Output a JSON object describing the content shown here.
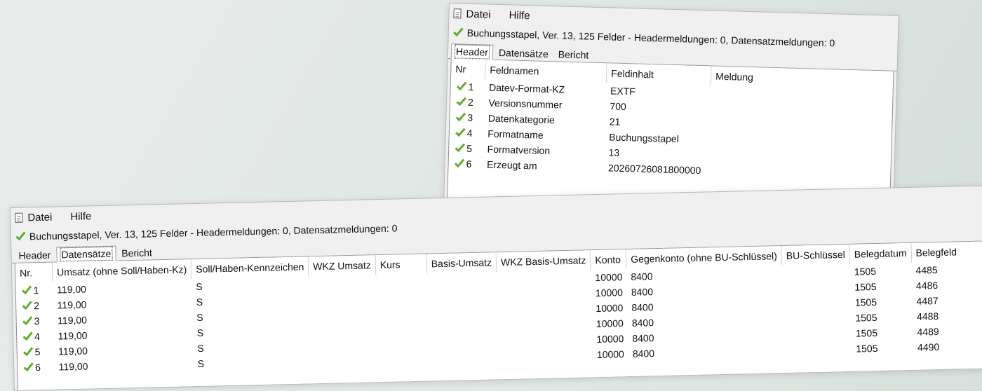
{
  "menu": {
    "file": "Datei",
    "help": "Hilfe"
  },
  "icons": {
    "file_menu": "document-icon",
    "status": "check-icon",
    "row": "check-icon"
  },
  "colors": {
    "check": "#5fae2e"
  },
  "back_window": {
    "status_text": "Buchungsstapel, Ver. 13, 125 Felder - Headermeldungen: 0, Datensatzmeldungen: 0",
    "tabs": [
      "Header",
      "Datensätze",
      "Bericht"
    ],
    "active_tab": "Header",
    "columns": [
      "Nr",
      "Feldnamen",
      "Feldinhalt",
      "Meldung"
    ],
    "rows": [
      {
        "nr": "1",
        "name": "Datev-Format-KZ",
        "value": "EXTF",
        "message": ""
      },
      {
        "nr": "2",
        "name": "Versionsnummer",
        "value": "700",
        "message": ""
      },
      {
        "nr": "3",
        "name": "Datenkategorie",
        "value": "21",
        "message": ""
      },
      {
        "nr": "4",
        "name": "Formatname",
        "value": "Buchungsstapel",
        "message": ""
      },
      {
        "nr": "5",
        "name": "Formatversion",
        "value": "13",
        "message": ""
      },
      {
        "nr": "6",
        "name": "Erzeugt am",
        "value": "20260726081800000",
        "message": ""
      }
    ]
  },
  "front_window": {
    "status_text": "Buchungsstapel, Ver. 13, 125 Felder - Headermeldungen: 0, Datensatzmeldungen: 0",
    "tabs": [
      "Header",
      "Datensätze",
      "Bericht"
    ],
    "active_tab": "Datensätze",
    "columns": [
      "Nr.",
      "Umsatz (ohne Soll/Haben-Kz)",
      "Soll/Haben-Kennzeichen",
      "WKZ Umsatz",
      "Kurs",
      "Basis-Umsatz",
      "WKZ Basis-Umsatz",
      "Konto",
      "Gegenkonto (ohne BU-Schlüssel)",
      "BU-Schlüssel",
      "Belegdatum",
      "Belegfeld"
    ],
    "rows": [
      {
        "nr": "1",
        "umsatz": "119,00",
        "sh": "S",
        "konto": "10000",
        "gegenkonto": "8400",
        "belegdatum": "1505",
        "belegfeld": "4485"
      },
      {
        "nr": "2",
        "umsatz": "119,00",
        "sh": "S",
        "konto": "10000",
        "gegenkonto": "8400",
        "belegdatum": "1505",
        "belegfeld": "4486"
      },
      {
        "nr": "3",
        "umsatz": "119,00",
        "sh": "S",
        "konto": "10000",
        "gegenkonto": "8400",
        "belegdatum": "1505",
        "belegfeld": "4487"
      },
      {
        "nr": "4",
        "umsatz": "119,00",
        "sh": "S",
        "konto": "10000",
        "gegenkonto": "8400",
        "belegdatum": "1505",
        "belegfeld": "4488"
      },
      {
        "nr": "5",
        "umsatz": "119,00",
        "sh": "S",
        "konto": "10000",
        "gegenkonto": "8400",
        "belegdatum": "1505",
        "belegfeld": "4489"
      },
      {
        "nr": "6",
        "umsatz": "119,00",
        "sh": "S",
        "konto": "10000",
        "gegenkonto": "8400",
        "belegdatum": "1505",
        "belegfeld": "4490"
      }
    ]
  }
}
